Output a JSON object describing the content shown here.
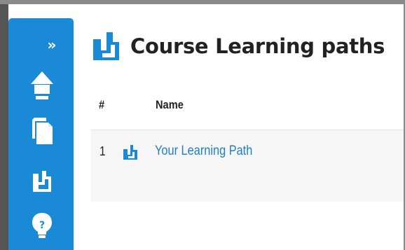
{
  "sidebar": {
    "collapse_glyph": "»",
    "items": [
      {
        "icon": "home-icon"
      },
      {
        "icon": "documents-icon"
      },
      {
        "icon": "learning-path-icon"
      },
      {
        "icon": "help-icon"
      }
    ]
  },
  "header": {
    "icon": "learning-path-icon",
    "title": "Course Learning paths"
  },
  "table": {
    "columns": [
      "#",
      "Name"
    ],
    "rows": [
      {
        "number": "1",
        "icon": "learning-path-icon",
        "name": "Your Learning Path"
      }
    ]
  },
  "colors": {
    "sidebar": "#1a8ad6",
    "accent": "#1f7fc4",
    "link": "#1f7fc4",
    "row_background": "#f6f6f6",
    "backdrop": "#8a8a8a"
  }
}
